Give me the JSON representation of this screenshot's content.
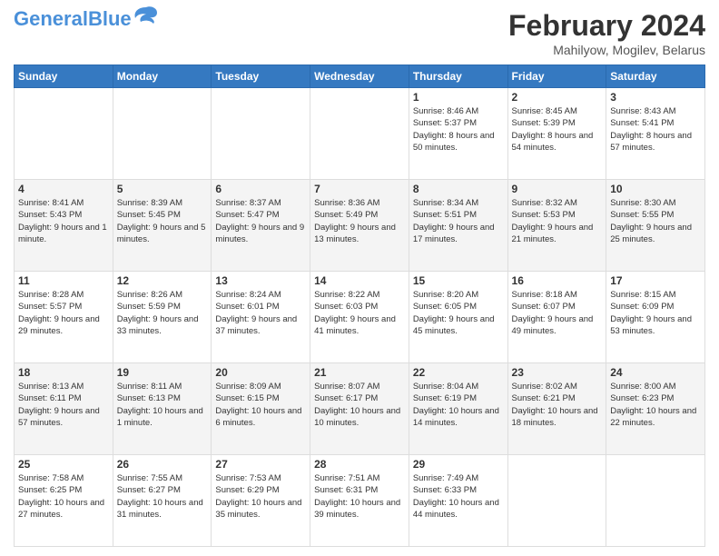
{
  "header": {
    "logo_general": "General",
    "logo_blue": "Blue",
    "month_title": "February 2024",
    "location": "Mahilyow, Mogilev, Belarus"
  },
  "days_of_week": [
    "Sunday",
    "Monday",
    "Tuesday",
    "Wednesday",
    "Thursday",
    "Friday",
    "Saturday"
  ],
  "weeks": [
    [
      {
        "day": "",
        "info": ""
      },
      {
        "day": "",
        "info": ""
      },
      {
        "day": "",
        "info": ""
      },
      {
        "day": "",
        "info": ""
      },
      {
        "day": "1",
        "info": "Sunrise: 8:46 AM\nSunset: 5:37 PM\nDaylight: 8 hours and 50 minutes."
      },
      {
        "day": "2",
        "info": "Sunrise: 8:45 AM\nSunset: 5:39 PM\nDaylight: 8 hours and 54 minutes."
      },
      {
        "day": "3",
        "info": "Sunrise: 8:43 AM\nSunset: 5:41 PM\nDaylight: 8 hours and 57 minutes."
      }
    ],
    [
      {
        "day": "4",
        "info": "Sunrise: 8:41 AM\nSunset: 5:43 PM\nDaylight: 9 hours and 1 minute."
      },
      {
        "day": "5",
        "info": "Sunrise: 8:39 AM\nSunset: 5:45 PM\nDaylight: 9 hours and 5 minutes."
      },
      {
        "day": "6",
        "info": "Sunrise: 8:37 AM\nSunset: 5:47 PM\nDaylight: 9 hours and 9 minutes."
      },
      {
        "day": "7",
        "info": "Sunrise: 8:36 AM\nSunset: 5:49 PM\nDaylight: 9 hours and 13 minutes."
      },
      {
        "day": "8",
        "info": "Sunrise: 8:34 AM\nSunset: 5:51 PM\nDaylight: 9 hours and 17 minutes."
      },
      {
        "day": "9",
        "info": "Sunrise: 8:32 AM\nSunset: 5:53 PM\nDaylight: 9 hours and 21 minutes."
      },
      {
        "day": "10",
        "info": "Sunrise: 8:30 AM\nSunset: 5:55 PM\nDaylight: 9 hours and 25 minutes."
      }
    ],
    [
      {
        "day": "11",
        "info": "Sunrise: 8:28 AM\nSunset: 5:57 PM\nDaylight: 9 hours and 29 minutes."
      },
      {
        "day": "12",
        "info": "Sunrise: 8:26 AM\nSunset: 5:59 PM\nDaylight: 9 hours and 33 minutes."
      },
      {
        "day": "13",
        "info": "Sunrise: 8:24 AM\nSunset: 6:01 PM\nDaylight: 9 hours and 37 minutes."
      },
      {
        "day": "14",
        "info": "Sunrise: 8:22 AM\nSunset: 6:03 PM\nDaylight: 9 hours and 41 minutes."
      },
      {
        "day": "15",
        "info": "Sunrise: 8:20 AM\nSunset: 6:05 PM\nDaylight: 9 hours and 45 minutes."
      },
      {
        "day": "16",
        "info": "Sunrise: 8:18 AM\nSunset: 6:07 PM\nDaylight: 9 hours and 49 minutes."
      },
      {
        "day": "17",
        "info": "Sunrise: 8:15 AM\nSunset: 6:09 PM\nDaylight: 9 hours and 53 minutes."
      }
    ],
    [
      {
        "day": "18",
        "info": "Sunrise: 8:13 AM\nSunset: 6:11 PM\nDaylight: 9 hours and 57 minutes."
      },
      {
        "day": "19",
        "info": "Sunrise: 8:11 AM\nSunset: 6:13 PM\nDaylight: 10 hours and 1 minute."
      },
      {
        "day": "20",
        "info": "Sunrise: 8:09 AM\nSunset: 6:15 PM\nDaylight: 10 hours and 6 minutes."
      },
      {
        "day": "21",
        "info": "Sunrise: 8:07 AM\nSunset: 6:17 PM\nDaylight: 10 hours and 10 minutes."
      },
      {
        "day": "22",
        "info": "Sunrise: 8:04 AM\nSunset: 6:19 PM\nDaylight: 10 hours and 14 minutes."
      },
      {
        "day": "23",
        "info": "Sunrise: 8:02 AM\nSunset: 6:21 PM\nDaylight: 10 hours and 18 minutes."
      },
      {
        "day": "24",
        "info": "Sunrise: 8:00 AM\nSunset: 6:23 PM\nDaylight: 10 hours and 22 minutes."
      }
    ],
    [
      {
        "day": "25",
        "info": "Sunrise: 7:58 AM\nSunset: 6:25 PM\nDaylight: 10 hours and 27 minutes."
      },
      {
        "day": "26",
        "info": "Sunrise: 7:55 AM\nSunset: 6:27 PM\nDaylight: 10 hours and 31 minutes."
      },
      {
        "day": "27",
        "info": "Sunrise: 7:53 AM\nSunset: 6:29 PM\nDaylight: 10 hours and 35 minutes."
      },
      {
        "day": "28",
        "info": "Sunrise: 7:51 AM\nSunset: 6:31 PM\nDaylight: 10 hours and 39 minutes."
      },
      {
        "day": "29",
        "info": "Sunrise: 7:49 AM\nSunset: 6:33 PM\nDaylight: 10 hours and 44 minutes."
      },
      {
        "day": "",
        "info": ""
      },
      {
        "day": "",
        "info": ""
      }
    ]
  ]
}
